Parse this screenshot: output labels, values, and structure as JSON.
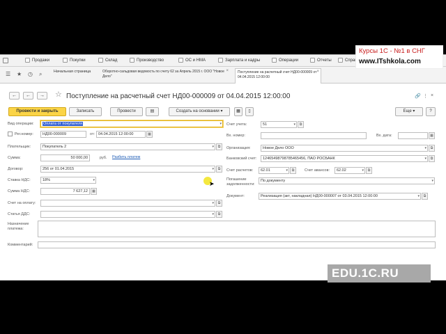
{
  "sections": [
    "Продажи",
    "Покупки",
    "Склад",
    "Производство",
    "ОС и НМА",
    "Зарплата и кадры",
    "Операции",
    "Отчеты",
    "Справочники"
  ],
  "tabs": [
    {
      "label": "Начальная страница",
      "active": false
    },
    {
      "label": "Оборотно-сальдовая ведомость по счету 62 за Апрель 2015 г. ООО \"Новое Дело\"",
      "active": false
    },
    {
      "label": "Поступление на расчетный счет НД00-000009 от 04.04.2015 12:00:00",
      "active": true
    }
  ],
  "document": {
    "title": "Поступление на расчетный счет НД00-000009 от 04.04.2015 12:00:00"
  },
  "toolbar": {
    "post_close": "Провести и закрыть",
    "save": "Записать",
    "post": "Провести",
    "create_based": "Создать на основании",
    "more": "Еще",
    "help": "?"
  },
  "form": {
    "op_type_label": "Вид операции:",
    "op_type_value": "Оплата от покупателя",
    "reg_num_label": "Рег.номер:",
    "reg_num_value": "НД00-000009",
    "from_label": "от:",
    "date_value": "04.04.2015 12:00:00",
    "payer_label": "Плательщик:",
    "payer_value": "Покупатель 2",
    "sum_label": "Сумма:",
    "sum_value": "50 000,00",
    "currency": "руб.",
    "split_link": "Разбить платеж",
    "contract_label": "Договор:",
    "contract_value": "256 от 01.04.2015",
    "vat_rate_label": "Ставка НДС:",
    "vat_rate_value": "18%",
    "vat_sum_label": "Сумма НДС:",
    "vat_sum_value": "7 627,12",
    "invoice_label": "Счет на оплату:",
    "invoice_value": "",
    "dds_label": "Статья ДДС:",
    "dds_value": "",
    "account_label": "Счет учета:",
    "account_value": "51",
    "in_num_label": "Вх. номер:",
    "in_num_value": "",
    "in_date_label": "Вх. дата:",
    "in_date_value": "",
    "org_label": "Организация:",
    "org_value": "Новое Дело ООО",
    "bank_acc_label": "Банковский счет:",
    "bank_acc_value": "12465498798785465456, ПАО РОСБАНК",
    "settle_acc_label": "Счет расчетов:",
    "settle_acc_value": "62.01",
    "adv_acc_label": "Счет авансов:",
    "adv_acc_value": "62.02",
    "debt_label_1": "Погашение",
    "debt_label_2": "задолженности:",
    "debt_value": "По документу",
    "doc_label": "Документ:",
    "doc_value": "Реализация (акт, накладная) НД00-000007 от 03.04.2015 12:00:00",
    "purpose_label_1": "Назначение",
    "purpose_label_2": "платежа:",
    "comment_label": "Комментарий:"
  },
  "promo": {
    "line1": "Курсы 1С - №1 в СНГ",
    "line2": "www.ITshkola.com"
  },
  "watermark": "EDU.1C.RU",
  "colors": {
    "primary_button": "#fbd446",
    "link": "#1c5bb5",
    "selection": "#2f5cd1",
    "promo_red": "#c81e1e"
  }
}
